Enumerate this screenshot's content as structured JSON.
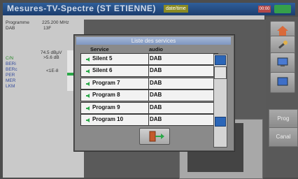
{
  "header": {
    "title": "Mesures-TV-Spectre (ST ETIENNE)",
    "date": "date/time",
    "badge_red": "00:00",
    "badge_green": "◼◼◼"
  },
  "info": {
    "program_label": "Programme",
    "program_value": "225.200 MHz",
    "dab_label": "DAB",
    "dab_value": "13F",
    "level_value": "74.5 dBµV",
    "level_sub": ">5.6 dB",
    "cn_label": "C/N",
    "beri_label": "BERi",
    "berc_label": "BERc",
    "berc_value": "<1E-8",
    "per_label": "PER",
    "mer_label": "MER",
    "lkm_label": "LKM"
  },
  "dialog": {
    "title": "Liste des services",
    "col_service": "Service",
    "col_audio": "audio",
    "rows": [
      {
        "service": "Silent 5",
        "audio": "DAB"
      },
      {
        "service": "Silent 6",
        "audio": "DAB"
      },
      {
        "service": "Program 7",
        "audio": "DAB"
      },
      {
        "service": "Program 8",
        "audio": "DAB"
      },
      {
        "service": "Program 9",
        "audio": "DAB"
      },
      {
        "service": "Program 10",
        "audio": "DAB"
      }
    ]
  },
  "sidebar": {
    "prog_label": "Prog",
    "cancel_label": "Canal"
  },
  "colors": {
    "titlebar": "#2f5f9a",
    "scroll_blue": "#2b66b8",
    "green_icon": "#2aa848"
  }
}
